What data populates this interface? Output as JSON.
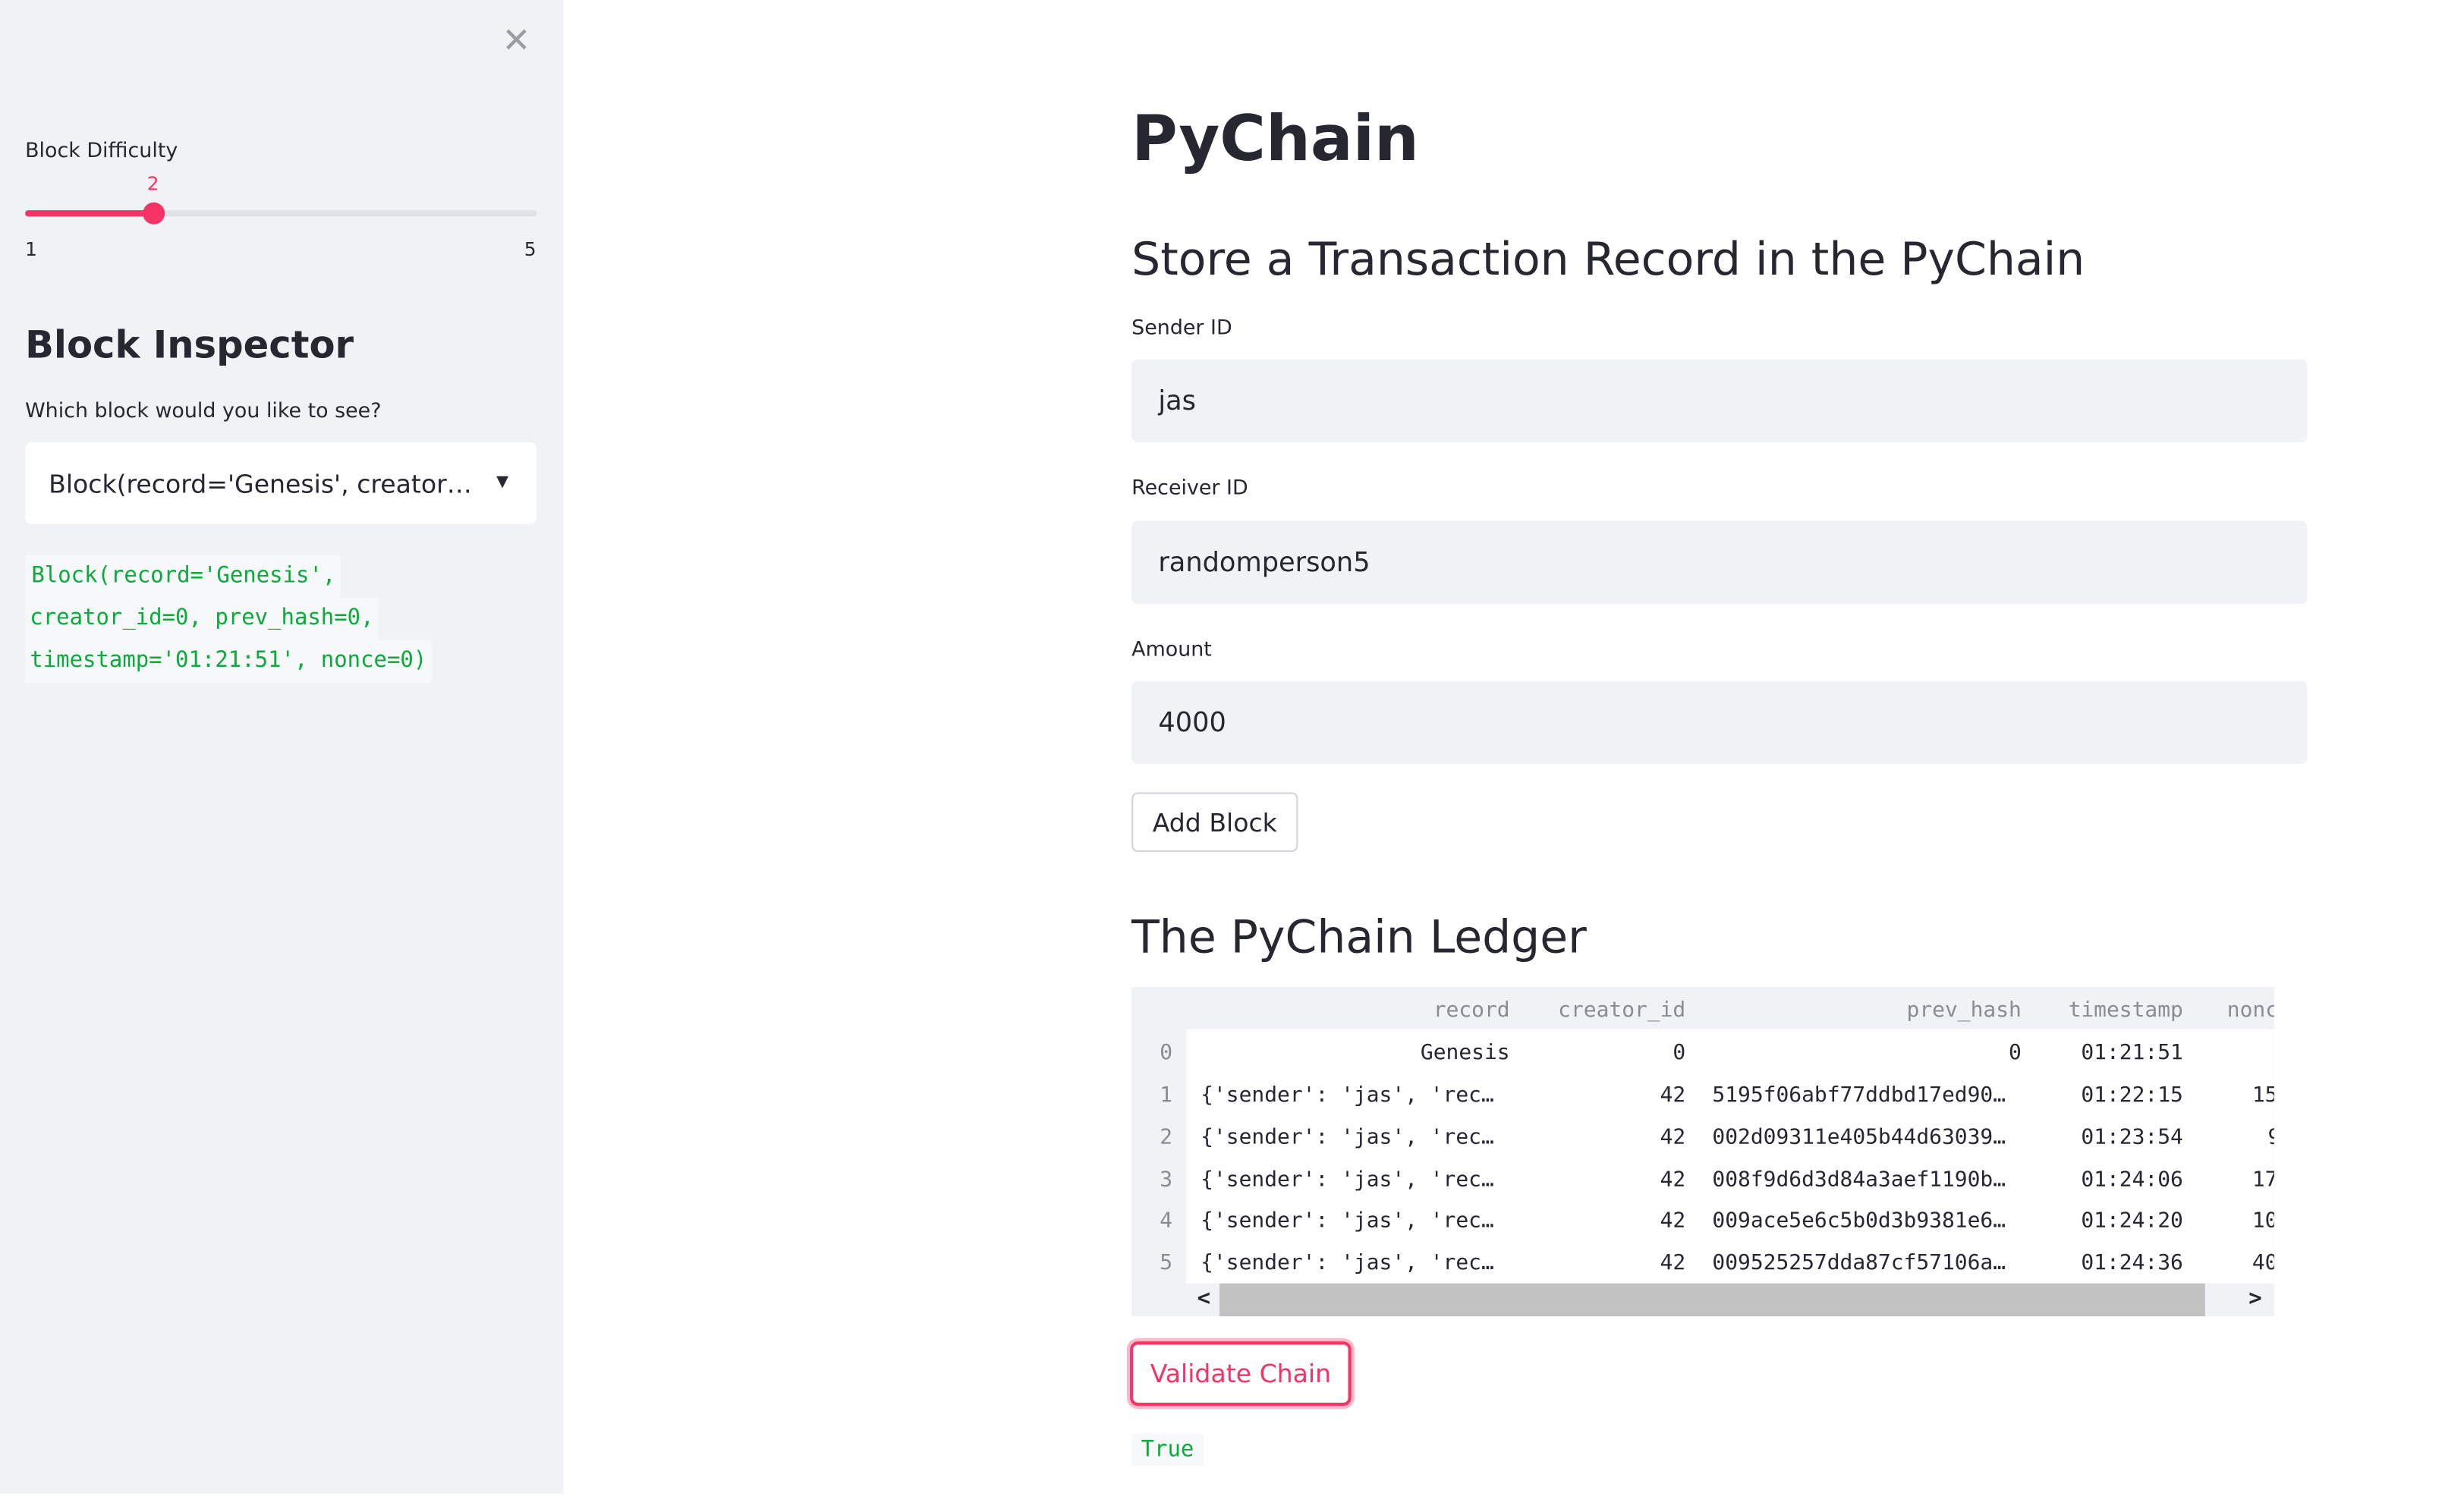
{
  "sidebar": {
    "close_icon": "close-icon",
    "slider": {
      "label": "Block Difficulty",
      "value": 2,
      "value_label": "2",
      "min": 1,
      "max": 5,
      "min_label": "1",
      "max_label": "5"
    },
    "heading": "Block Inspector",
    "question": "Which block would you like to see?",
    "select": {
      "value": "Block(record='Genesis', creator_i...",
      "caret_icon": "caret-down-icon"
    },
    "code_output": [
      "Block(record='Genesis',",
      "creator_id=0, prev_hash=0,",
      "timestamp='01:21:51', nonce=0)"
    ]
  },
  "main": {
    "title": "PyChain",
    "subtitle": "Store a Transaction Record in the PyChain",
    "fields": [
      {
        "label": "Sender ID",
        "value": "jas"
      },
      {
        "label": "Receiver ID",
        "value": "randomperson5"
      },
      {
        "label": "Amount",
        "value": "4000"
      }
    ],
    "add_button": "Add Block",
    "ledger_title": "The PyChain Ledger",
    "table": {
      "columns": [
        "record",
        "creator_id",
        "prev_hash",
        "timestamp",
        "nonc"
      ],
      "rows": [
        {
          "index": "0",
          "record": "Genesis",
          "creator_id": "0",
          "prev_hash": "0",
          "timestamp": "01:21:51",
          "nonce": ""
        },
        {
          "index": "1",
          "record": "{'sender': 'jas', 'rec…",
          "creator_id": "42",
          "prev_hash": "5195f06abf77ddbd17ed90…",
          "timestamp": "01:22:15",
          "nonce": "15"
        },
        {
          "index": "2",
          "record": "{'sender': 'jas', 'rec…",
          "creator_id": "42",
          "prev_hash": "002d09311e405b44d63039…",
          "timestamp": "01:23:54",
          "nonce": "9"
        },
        {
          "index": "3",
          "record": "{'sender': 'jas', 'rec…",
          "creator_id": "42",
          "prev_hash": "008f9d6d3d84a3aef1190b…",
          "timestamp": "01:24:06",
          "nonce": "17"
        },
        {
          "index": "4",
          "record": "{'sender': 'jas', 'rec…",
          "creator_id": "42",
          "prev_hash": "009ace5e6c5b0d3b9381e6…",
          "timestamp": "01:24:20",
          "nonce": "10"
        },
        {
          "index": "5",
          "record": "{'sender': 'jas', 'rec…",
          "creator_id": "42",
          "prev_hash": "009525257dda87cf57106a…",
          "timestamp": "01:24:36",
          "nonce": "40"
        }
      ]
    },
    "validate_button": "Validate Chain",
    "validate_result": "True"
  },
  "colors": {
    "accent": "#f63366",
    "success": "#09ab3b",
    "sidebar_bg": "#f0f2f6"
  }
}
